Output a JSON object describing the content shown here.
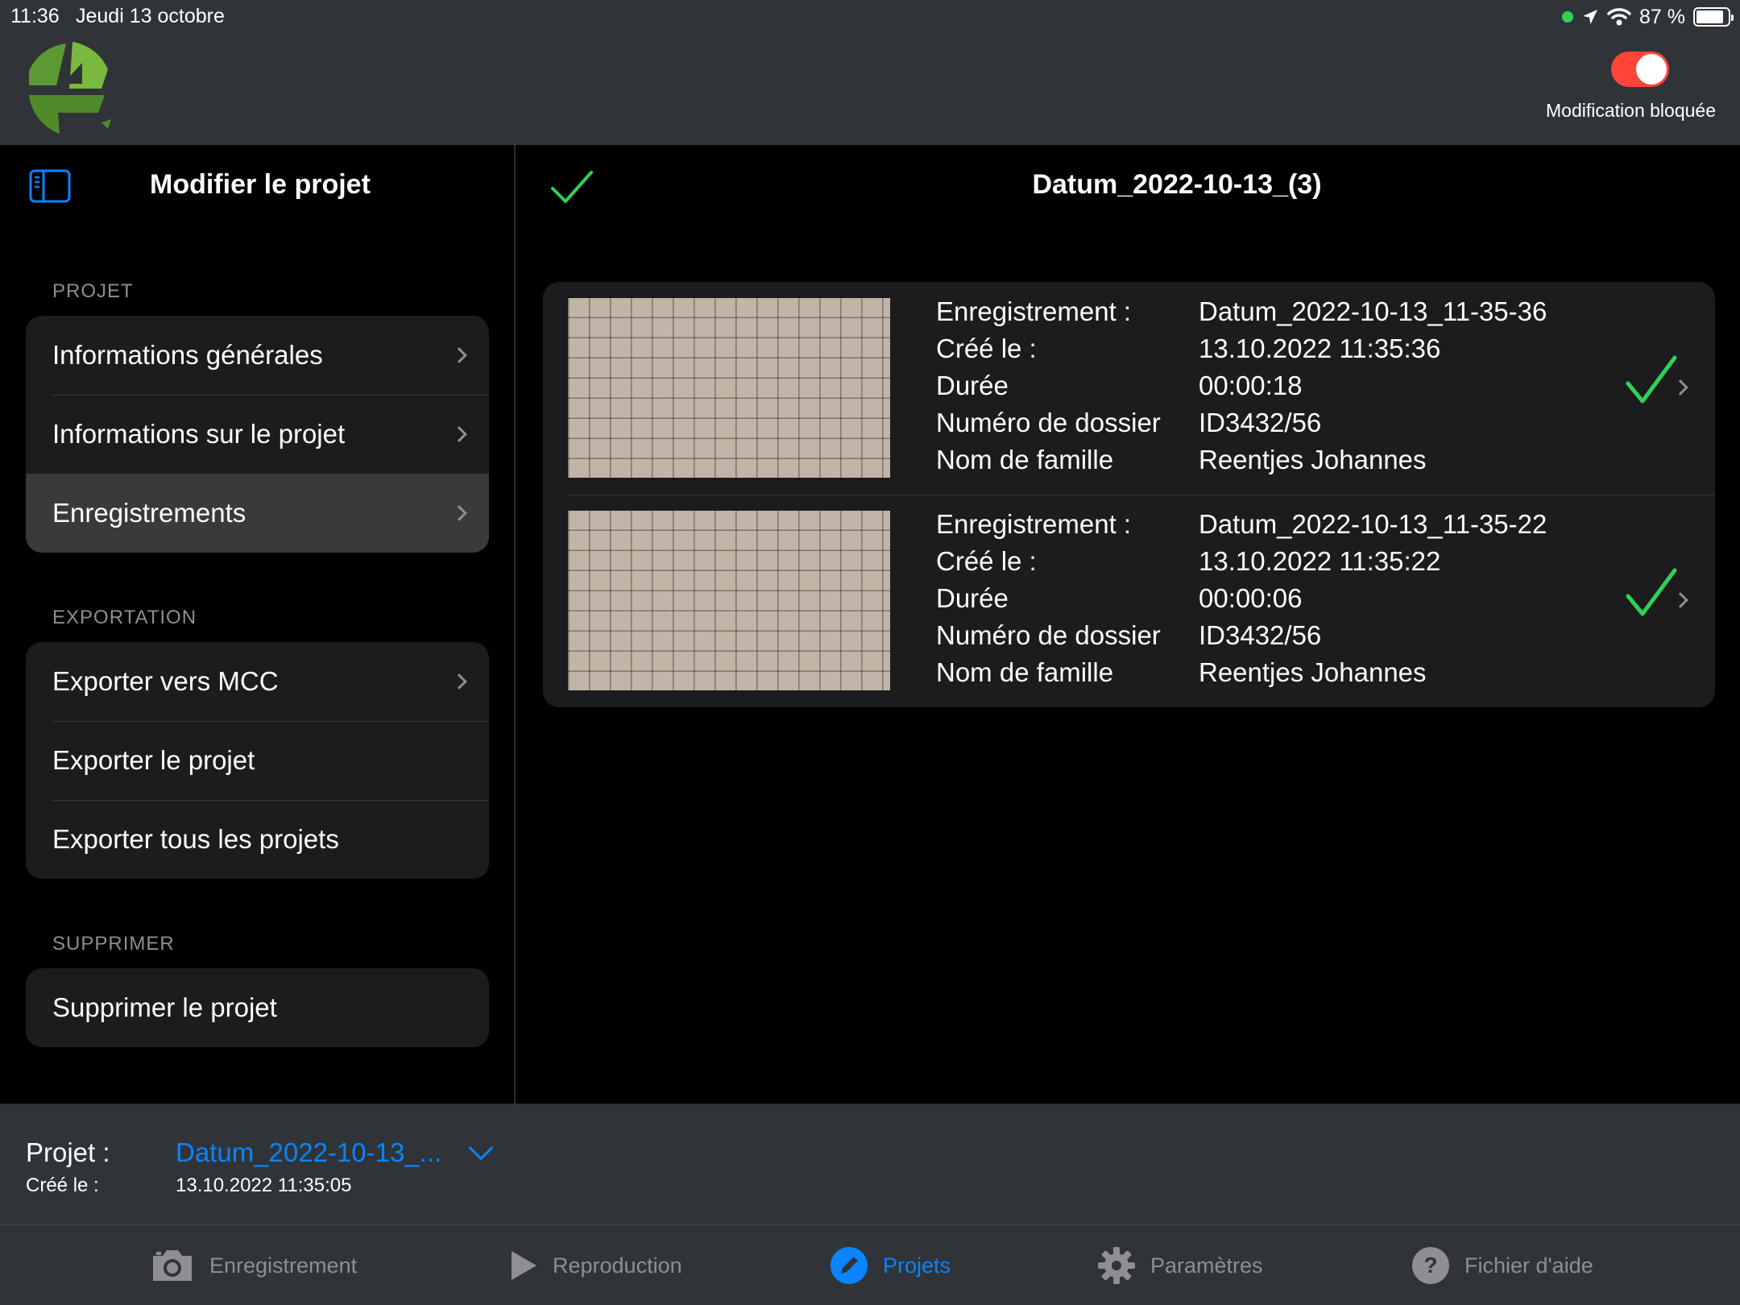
{
  "status_bar": {
    "time": "11:36",
    "date": "Jeudi 13 octobre",
    "battery": "87 %",
    "battery_level": 0.87
  },
  "header": {
    "lock_label": "Modification bloquée",
    "lock_on": true
  },
  "sidebar": {
    "title": "Modifier le projet",
    "sections": [
      {
        "header": "PROJET",
        "items": [
          "Informations générales",
          "Informations sur le projet",
          "Enregistrements"
        ]
      },
      {
        "header": "EXPORTATION",
        "items": [
          "Exporter vers MCC",
          "Exporter le projet",
          "Exporter tous les projets"
        ]
      },
      {
        "header": "SUPPRIMER",
        "items": [
          "Supprimer le projet"
        ]
      }
    ],
    "selected_item": "Enregistrements"
  },
  "detail": {
    "title": "Datum_2022-10-13_(3)",
    "labels": {
      "recording": "Enregistrement :",
      "created": "Créé le :",
      "duration": "Durée",
      "file_number": "Numéro de dossier",
      "family_name": "Nom de famille"
    },
    "recordings": [
      {
        "name": "Datum_2022-10-13_11-35-36",
        "created": "13.10.2022 11:35:36",
        "duration": "00:00:18",
        "file_number": "ID3432/56",
        "family_name": "Reentjes Johannes"
      },
      {
        "name": "Datum_2022-10-13_11-35-22",
        "created": "13.10.2022 11:35:22",
        "duration": "00:00:06",
        "file_number": "ID3432/56",
        "family_name": "Reentjes Johannes"
      }
    ]
  },
  "project_bar": {
    "project_label": "Projet :",
    "project_name": "Datum_2022-10-13_...",
    "created_label": "Créé le :",
    "created_value": "13.10.2022 11:35:05"
  },
  "tabbar": {
    "tabs": [
      {
        "label": "Enregistrement",
        "icon": "camera-icon"
      },
      {
        "label": "Reproduction",
        "icon": "play-icon"
      },
      {
        "label": "Projets",
        "icon": "pencil-icon"
      },
      {
        "label": "Paramètres",
        "icon": "gear-icon"
      },
      {
        "label": "Fichier d'aide",
        "icon": "help-icon"
      }
    ],
    "active": "Projets"
  },
  "colors": {
    "accent": "#0a84ff",
    "check": "#31d158",
    "toggle_on": "#ff453a",
    "header_bg": "#303438",
    "cell_bg": "#1c1c1e"
  }
}
